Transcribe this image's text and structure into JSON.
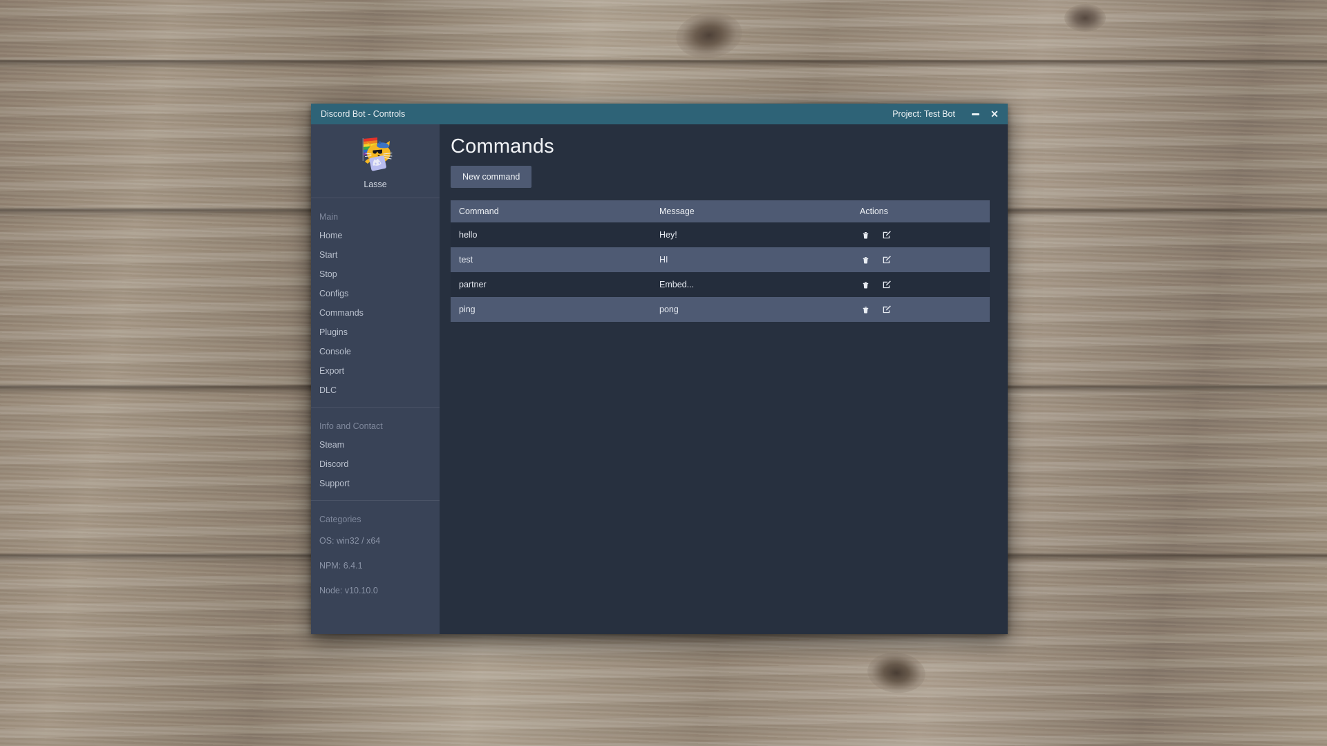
{
  "window": {
    "title": "Discord Bot - Controls",
    "project_label": "Project: Test Bot",
    "minimize_icon": "minimize-icon",
    "close_icon": "close-icon",
    "close_glyph": "✕",
    "titlebar_color": "#2e6377",
    "sidebar_color": "#394357",
    "content_color": "#27303f",
    "accent_color": "#4e5a73"
  },
  "sidebar": {
    "profile": {
      "name": "Lasse",
      "avatar_icon": "cat-with-rainbow-flag-avatar"
    },
    "sections": [
      {
        "heading": "Main",
        "items": [
          {
            "label": "Home"
          },
          {
            "label": "Start"
          },
          {
            "label": "Stop"
          },
          {
            "label": "Configs"
          },
          {
            "label": "Commands"
          },
          {
            "label": "Plugins"
          },
          {
            "label": "Console"
          },
          {
            "label": "Export"
          },
          {
            "label": "DLC"
          }
        ]
      },
      {
        "heading": "Info and Contact",
        "items": [
          {
            "label": "Steam"
          },
          {
            "label": "Discord"
          },
          {
            "label": "Support"
          }
        ]
      }
    ],
    "categories": {
      "heading": "Categories",
      "items": [
        {
          "label": "OS: win32 / x64"
        },
        {
          "label": "NPM: 6.4.1"
        },
        {
          "label": "Node: v10.10.0"
        }
      ]
    }
  },
  "main": {
    "title": "Commands",
    "new_command_label": "New command",
    "table": {
      "columns": [
        "Command",
        "Message",
        "Actions"
      ],
      "rows": [
        {
          "command": "hello",
          "message": "Hey!",
          "delete_icon": "trash-icon",
          "edit_icon": "edit-pencil-icon"
        },
        {
          "command": "test",
          "message": "HI",
          "delete_icon": "trash-icon",
          "edit_icon": "edit-pencil-icon"
        },
        {
          "command": "partner",
          "message": "Embed...",
          "delete_icon": "trash-icon",
          "edit_icon": "edit-pencil-icon"
        },
        {
          "command": "ping",
          "message": "pong",
          "delete_icon": "trash-icon",
          "edit_icon": "edit-pencil-icon"
        }
      ]
    }
  }
}
